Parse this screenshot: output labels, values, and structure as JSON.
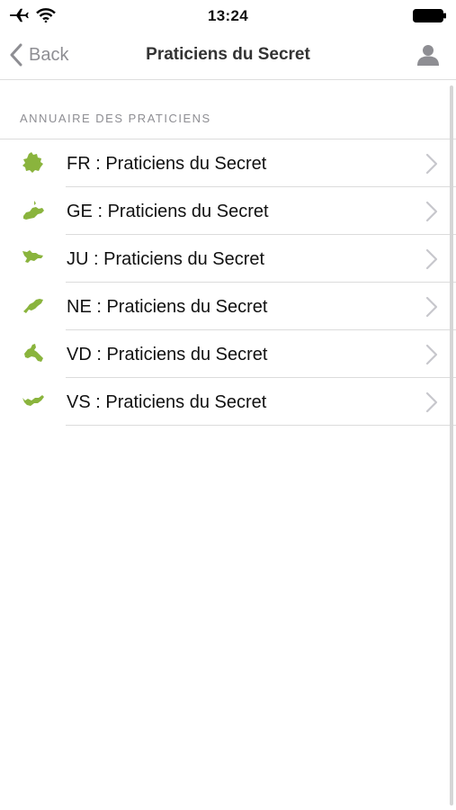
{
  "status_bar": {
    "time": "13:24",
    "icons": [
      "airplane-icon",
      "wifi-icon",
      "battery-icon"
    ]
  },
  "nav": {
    "back_label": "Back",
    "title": "Praticiens du Secret",
    "right_icon": "user-icon"
  },
  "section": {
    "header": "ANNUAIRE DES PRATICIENS"
  },
  "list": {
    "items": [
      {
        "label": "FR : Praticiens du Secret",
        "icon": "canton-fr-icon"
      },
      {
        "label": "GE : Praticiens du Secret",
        "icon": "canton-ge-icon"
      },
      {
        "label": "JU : Praticiens du Secret",
        "icon": "canton-ju-icon"
      },
      {
        "label": "NE : Praticiens du Secret",
        "icon": "canton-ne-icon"
      },
      {
        "label": "VD : Praticiens du Secret",
        "icon": "canton-vd-icon"
      },
      {
        "label": "VS : Praticiens du Secret",
        "icon": "canton-vs-icon"
      }
    ]
  },
  "colors": {
    "accent_green": "#8ab43d",
    "chevron_gray": "#c7c7cc",
    "muted_gray": "#8e8e93"
  }
}
